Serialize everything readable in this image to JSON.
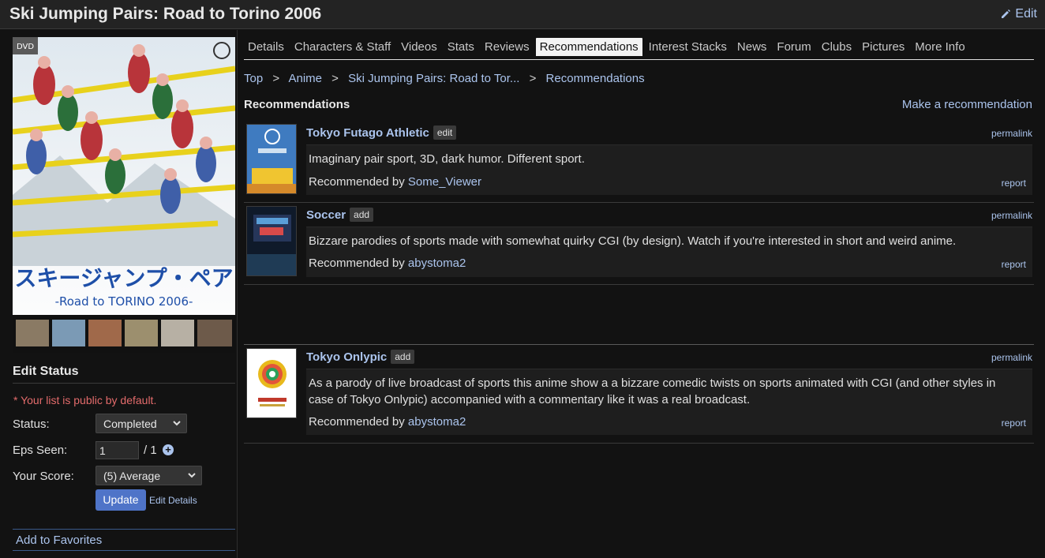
{
  "header": {
    "title": "Ski Jumping Pairs: Road to Torino 2006",
    "edit_label": "Edit"
  },
  "tabs": [
    {
      "label": "Details"
    },
    {
      "label": "Characters & Staff"
    },
    {
      "label": "Videos"
    },
    {
      "label": "Stats"
    },
    {
      "label": "Reviews"
    },
    {
      "label": "Recommendations",
      "active": true
    },
    {
      "label": "Interest Stacks"
    },
    {
      "label": "News"
    },
    {
      "label": "Forum"
    },
    {
      "label": "Clubs"
    },
    {
      "label": "Pictures"
    },
    {
      "label": "More Info"
    }
  ],
  "breadcrumb": {
    "items": [
      "Top",
      "Anime",
      "Ski Jumping Pairs: Road to Tor...",
      "Recommendations"
    ],
    "separator": ">"
  },
  "cover": {
    "title_jp": "スキージャンプ・ペア",
    "subtitle": "-Road to TORINO 2006-"
  },
  "edit_status": {
    "heading": "Edit Status",
    "public_note": "* Your list is public by default.",
    "status_label": "Status:",
    "status_value": "Completed",
    "eps_label": "Eps Seen:",
    "eps_value": "1",
    "eps_total": "/ 1",
    "score_label": "Your Score:",
    "score_value": "(5) Average",
    "update_label": "Update",
    "edit_details_label": "Edit Details",
    "favorites_label": "Add to Favorites"
  },
  "recommendations": {
    "heading": "Recommendations",
    "make_label": "Make a recommendation",
    "permalink_label": "permalink",
    "report_label": "report",
    "by_prefix": "Recommended by ",
    "items": [
      {
        "title": "Tokyo Futago Athletic",
        "tag": "edit",
        "text": "Imaginary pair sport, 3D, dark humor. Different sport.",
        "user": "Some_Viewer"
      },
      {
        "title": "Soccer",
        "tag": "add",
        "text": "Bizzare parodies of sports made with somewhat quirky CGI (by design). Watch if you're interested in short and weird anime.",
        "user": "abystoma2"
      },
      {
        "title": "Tokyo Onlypic",
        "tag": "add",
        "text": "As a parody of live broadcast of sports this anime show a a bizzare comedic twists on sports animated with CGI (and other styles in case of Tokyo Onlypic) accompanied with a commentary like it was a real broadcast.",
        "user": "abystoma2",
        "thumb_text": "東京2008 ONLYPIC"
      }
    ]
  },
  "colors": {
    "background": "#121212",
    "link": "#abc4ed",
    "accent_button": "#4f74c8",
    "warning": "#e36b6b"
  }
}
